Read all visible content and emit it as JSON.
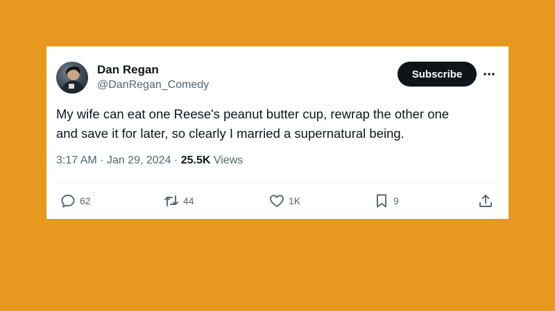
{
  "colors": {
    "background": "#E8981E",
    "card": "#FFFFFF",
    "text_primary": "#0F1419",
    "text_secondary": "#536471",
    "subscribe_bg": "#0F1419"
  },
  "author": {
    "name": "Dan Regan",
    "handle": "@DanRegan_Comedy",
    "avatar_icon": "avatar-photo"
  },
  "header": {
    "subscribe_label": "Subscribe",
    "more_icon": "more-horizontal-icon"
  },
  "tweet": {
    "text_lines": [
      "My wife can eat one Reese's peanut butter cup, rewrap the other one",
      "and save it for later, so clearly I married a supernatural being."
    ]
  },
  "meta": {
    "time": "3:17 AM",
    "separator": "·",
    "date": "Jan 29, 2024",
    "views_count": "25.5K",
    "views_label": "Views"
  },
  "actions": {
    "reply": {
      "icon": "reply-icon",
      "count": "62"
    },
    "retweet": {
      "icon": "retweet-icon",
      "count": "44"
    },
    "like": {
      "icon": "heart-icon",
      "count": "1K"
    },
    "bookmark": {
      "icon": "bookmark-icon",
      "count": "9"
    },
    "share": {
      "icon": "share-icon"
    }
  }
}
